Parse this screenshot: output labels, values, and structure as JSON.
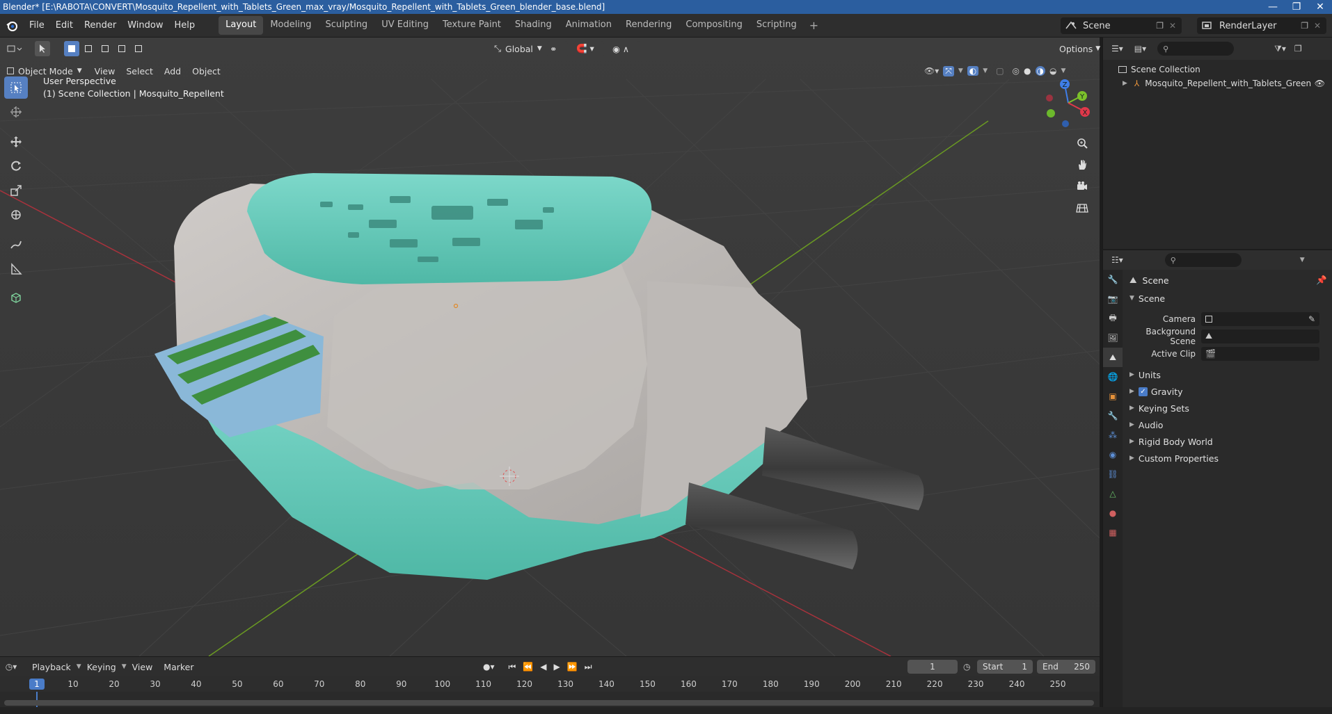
{
  "window": {
    "title": "Blender* [E:\\RABOTA\\CONVERT\\Mosquito_Repellent_with_Tablets_Green_max_vray/Mosquito_Repellent_with_Tablets_Green_blender_base.blend]",
    "minimize": "—",
    "maximize": "❐",
    "close": "✕"
  },
  "menu": [
    "File",
    "Edit",
    "Render",
    "Window",
    "Help"
  ],
  "workspaces": {
    "tabs": [
      "Layout",
      "Modeling",
      "Sculpting",
      "UV Editing",
      "Texture Paint",
      "Shading",
      "Animation",
      "Rendering",
      "Compositing",
      "Scripting"
    ],
    "active": "Layout",
    "add": "+"
  },
  "scene_selector": "Scene",
  "render_layer": "RenderLayer",
  "viewport_header": {
    "mode": "Object Mode",
    "menus": [
      "View",
      "Select",
      "Add",
      "Object"
    ],
    "transform_orientation": "Global",
    "options": "Options"
  },
  "viewport_overlay": {
    "perspective": "User Perspective",
    "collection_info": "(1) Scene Collection | Mosquito_Repellent"
  },
  "gizmo_axes": {
    "z": "Z",
    "y": "Y",
    "x": "X"
  },
  "colors": {
    "accent": "#4a7cc8",
    "titlebar": "#2b5e9f",
    "x_axis": "#e0384a",
    "y_axis": "#7cc12a",
    "z_axis": "#3f7ee8",
    "model_teal": "#5fc8b6",
    "model_grey": "#b9b6b3"
  },
  "timeline": {
    "menus": [
      "Playback",
      "Keying",
      "View",
      "Marker"
    ],
    "current_frame": "1",
    "start_label": "Start",
    "start_value": "1",
    "end_label": "End",
    "end_value": "250",
    "ticks": [
      "1",
      "10",
      "20",
      "30",
      "40",
      "50",
      "60",
      "70",
      "80",
      "90",
      "100",
      "110",
      "120",
      "130",
      "140",
      "150",
      "160",
      "170",
      "180",
      "190",
      "200",
      "210",
      "220",
      "230",
      "240",
      "250"
    ]
  },
  "outliner": {
    "root": "Scene Collection",
    "items": [
      "Mosquito_Repellent_with_Tablets_Green"
    ]
  },
  "properties": {
    "context": "Scene",
    "panel": "Scene",
    "fields": [
      {
        "label": "Camera",
        "value": ""
      },
      {
        "label": "Background Scene",
        "value": ""
      },
      {
        "label": "Active Clip",
        "value": ""
      }
    ],
    "subpanels": [
      "Units",
      "Gravity",
      "Keying Sets",
      "Audio",
      "Rigid Body World",
      "Custom Properties"
    ],
    "gravity_checked": true
  }
}
